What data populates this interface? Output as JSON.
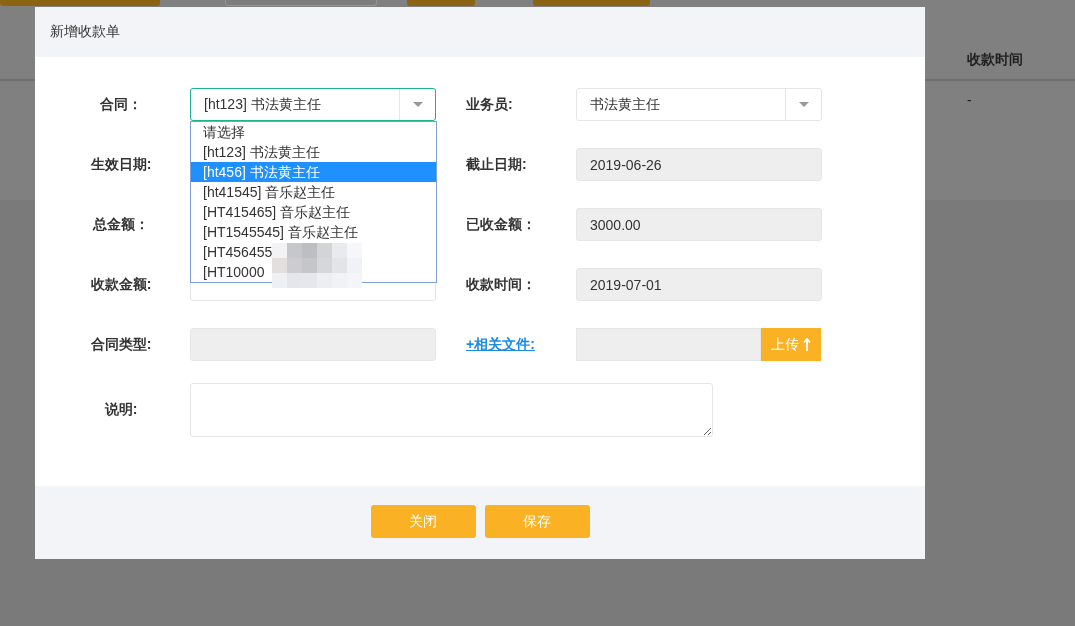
{
  "background": {
    "toolbar_buttons": [
      {
        "kind": "primary"
      },
      {
        "kind": "default"
      },
      {
        "kind": "primary"
      },
      {
        "kind": "primary"
      }
    ],
    "table": {
      "columns": [
        "收款时间"
      ],
      "rows": [
        [
          "-"
        ]
      ]
    }
  },
  "dialog": {
    "title": "新增收款单",
    "rows": [
      [
        {
          "label": "合同：",
          "kind": "select",
          "value": "[ht123] 书法黄主任",
          "focused": true,
          "expanded": true
        },
        {
          "label": "业务员:",
          "kind": "select",
          "value": "书法黄主任",
          "focused": false
        }
      ],
      [
        {
          "label": "生效日期:"
        },
        {
          "label": "截止日期:",
          "kind": "input",
          "value": "2019-06-26",
          "disabled": true
        }
      ],
      [
        {
          "label": "总金额："
        },
        {
          "label": "已收金额：",
          "kind": "input",
          "value": "3000.00",
          "disabled": true
        }
      ],
      [
        {
          "label": "收款金额:",
          "kind": "input",
          "disabled": false
        },
        {
          "label": "收款时间：",
          "kind": "input",
          "value": "2019-07-01",
          "disabled": true
        }
      ],
      [
        {
          "label": "合同类型:",
          "kind": "input",
          "disabled": true
        },
        {
          "label": "+相关文件:",
          "kind": "upload",
          "disabled": true,
          "button": "上传"
        }
      ],
      [
        {
          "label": "说明:",
          "kind": "textarea"
        }
      ]
    ],
    "dropdown": {
      "options": [
        {
          "label": "请选择",
          "selected": false
        },
        {
          "label": "[ht123] 书法黄主任",
          "selected": false
        },
        {
          "label": "[ht456] 书法黄主任",
          "selected": true
        },
        {
          "label": "[ht41545] 音乐赵主任",
          "selected": false
        },
        {
          "label": "[HT415465] 音乐赵主任",
          "selected": false
        },
        {
          "label": "[HT1545545] 音乐赵主任",
          "selected": false
        },
        {
          "label": "[HT456455",
          "selected": false
        },
        {
          "label": "[HT10000",
          "selected": false
        }
      ]
    },
    "buttons": [
      "关闭",
      "保存"
    ]
  }
}
